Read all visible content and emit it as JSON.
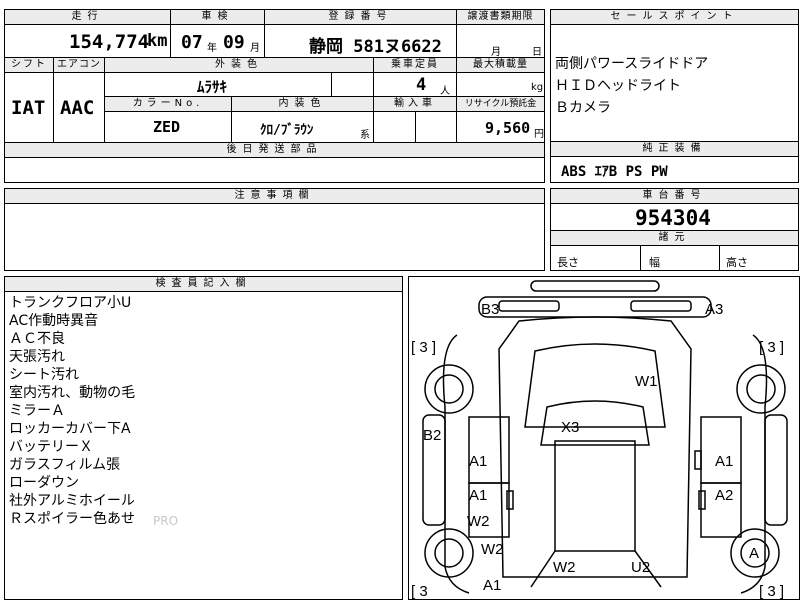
{
  "top_labels": {
    "mileage": "走行",
    "inspection": "車検",
    "registration": "登録番号",
    "transfer_docs": "譲渡書類期限",
    "sales_points": "セールスポイント",
    "shift": "シフト",
    "aircon": "エアコン",
    "exterior_color": "外装色",
    "capacity": "乗車定員",
    "max_load": "最大積載量",
    "color_no": "カラーNo.",
    "interior_color": "内装色",
    "import": "輸入車",
    "recycle": "リサイクル預託金",
    "later_parts": "後日発送部品",
    "standard_equipment": "純正装備",
    "caution": "注意事項欄",
    "chassis_no": "車台番号",
    "specs": "諸元",
    "inspector": "検査員記入欄"
  },
  "vehicle": {
    "mileage_value": "154,774",
    "mileage_unit": "km",
    "inspection_year": "07",
    "year_unit": "年",
    "inspection_month": "09",
    "month_unit": "月",
    "registration_number": "静岡 581ヌ6622",
    "transfer_month_unit": "月",
    "transfer_day_unit": "日",
    "shift_value": "IAT",
    "aircon_value": "AAC",
    "exterior_color_value": "ﾑﾗｻｷ",
    "capacity_value": "4",
    "capacity_unit": "人",
    "load_unit": "kg",
    "color_no_value": "ZED",
    "interior_color_value": "ｸﾛ/ﾌﾞﾗｳﾝ",
    "interior_suffix": "系",
    "recycle_value": "9,560",
    "recycle_unit": "円",
    "chassis_value": "954304",
    "length_label": "長さ",
    "width_label": "幅",
    "height_label": "高さ",
    "standard_equipment_value": "ABS ｴｱB PS PW"
  },
  "sales_points": [
    "両側パワースライドドア",
    "ＨＩＤヘッドライト",
    "Ｂカメラ"
  ],
  "inspector_notes": [
    "トランクフロア小U",
    "AC作動時異音",
    "ＡＣ不良",
    "天張汚れ",
    "シート汚れ",
    "室内汚れ、動物の毛",
    "ミラーＡ",
    "ロッカーカバー下A",
    "バッテリーＸ",
    "ガラスフィルム張",
    "ローダウン",
    "社外アルミホイール",
    "Ｒスポイラー色あせ"
  ],
  "watermark": "PRO",
  "diagram": {
    "tire_left_top": "[ 3 ]",
    "tire_right_top": "[ 3 ]",
    "tire_left_bottom": "[ 3",
    "tire_right_bottom": "[ 3 ]",
    "b3": "B3",
    "a3": "A3",
    "w1": "W1",
    "x3": "X3",
    "b2": "B2",
    "a1_front_left": "A1",
    "a1_front_right": "A1",
    "a1_rear_left": "A1",
    "a2_rear_right": "A2",
    "w2_left_a": "W2",
    "w2_left_b": "W2",
    "w2_bottom": "W2",
    "u2_bottom": "U2",
    "a1_bottom": "A1",
    "a_wheel": "A"
  }
}
